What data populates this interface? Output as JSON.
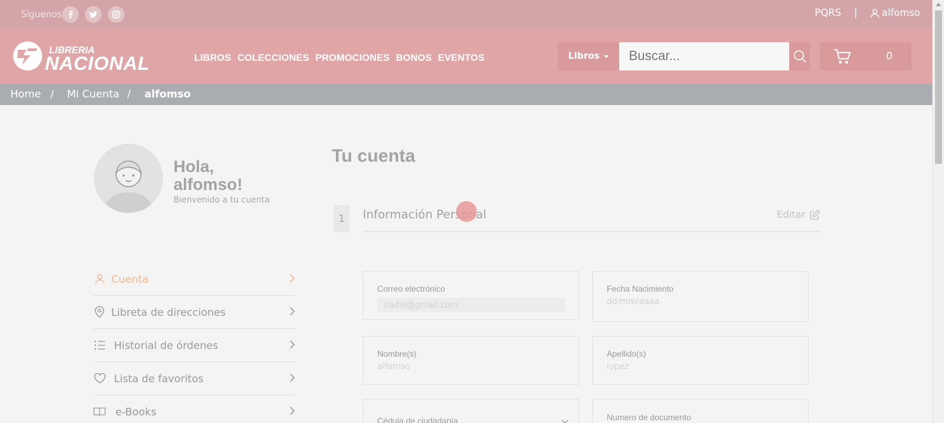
{
  "topbar": {
    "follow_label": "Síguenos",
    "social": [
      "facebook-icon",
      "twitter-icon",
      "instagram-icon"
    ],
    "pqrs": "PQRS",
    "separator": "|",
    "username": "alfomso"
  },
  "header": {
    "logo_line1": "LIBRERIA",
    "logo_line2": "NACIONAL",
    "nav": [
      "LIBROS",
      "COLECCIONES",
      "PROMOCIONES",
      "BONOS",
      "EVENTOS"
    ],
    "search": {
      "category": "Libros",
      "placeholder": "Buscar..."
    },
    "cart_count": "0"
  },
  "breadcrumb": {
    "items": [
      "Home",
      "Mi Cuenta",
      "alfomso"
    ],
    "separator": "/"
  },
  "profile": {
    "greeting_line1": "Hola,",
    "greeting_line2": "alfomso!",
    "welcome": "Bienvenido a tu cuenta"
  },
  "sidebar": {
    "items": [
      {
        "label": "Cuenta",
        "icon": "user-icon",
        "active": true
      },
      {
        "label": "Libreta de direcciones",
        "icon": "location-pin-icon",
        "active": false
      },
      {
        "label": "Historial de órdenes",
        "icon": "list-icon",
        "active": false
      },
      {
        "label": "Lista de favoritos",
        "icon": "heart-icon",
        "active": false
      },
      {
        "label": "e-Books",
        "icon": "book-icon",
        "active": false
      }
    ]
  },
  "main": {
    "title": "Tu cuenta",
    "section": {
      "number": "1",
      "title": "Información Personal",
      "edit_label": "Editar"
    },
    "fields": {
      "email": {
        "label": "Correo electrónico",
        "value": "nadie@gmail.com"
      },
      "birthdate": {
        "label": "Fecha Nacimiento",
        "value": "dd/mm/aaaa"
      },
      "first_name": {
        "label": "Nombre(s)",
        "value": "alfomso"
      },
      "last_name": {
        "label": "Apellido(s)",
        "value": "lopez"
      },
      "id_type": {
        "label": "Cédula de ciudadanía"
      },
      "id_number": {
        "label": "Numero de documento"
      }
    }
  },
  "colors": {
    "topbar": "#d3a5a8",
    "header": "#e0a5a7",
    "breadcrumb": "#a9adb2",
    "accent": "#f3b68e"
  }
}
